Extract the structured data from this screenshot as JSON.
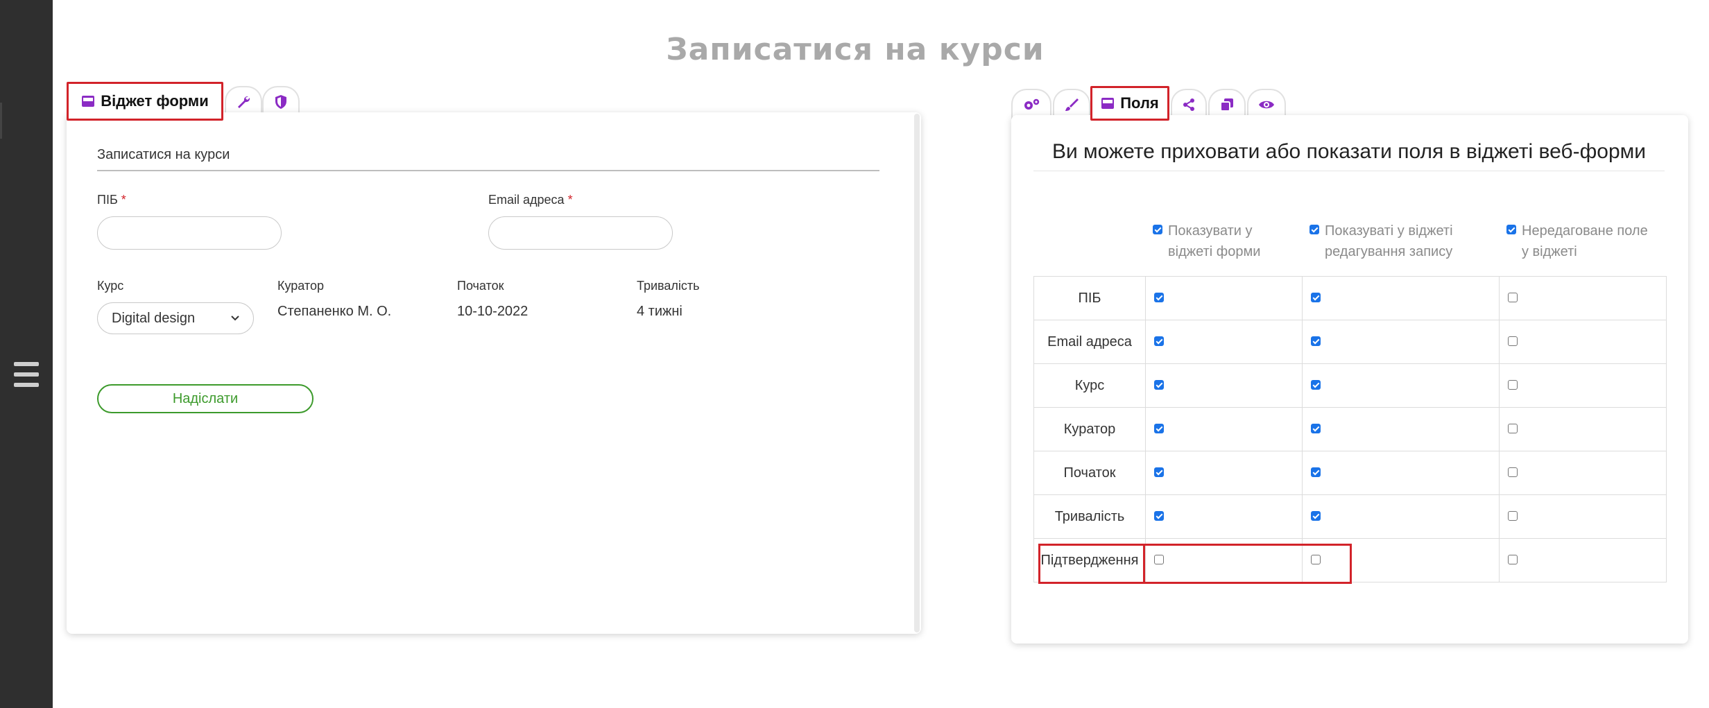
{
  "page": {
    "title": "Записатися на курси"
  },
  "left_tabs": {
    "active_label": "Віджет форми",
    "icons": [
      "form-icon",
      "wrench-icon",
      "shield-icon"
    ]
  },
  "form": {
    "title": "Записатися на курси",
    "name_label": "ПІБ",
    "email_label": "Email адреса",
    "required_mark": "*",
    "course_label": "Курс",
    "course_value": "Digital design",
    "curator_label": "Куратор",
    "curator_value": "Степаненко М. О.",
    "start_label": "Початок",
    "start_value": "10-10-2022",
    "duration_label": "Тривалість",
    "duration_value": "4 тижні",
    "submit_label": "Надіслати"
  },
  "right_tabs": {
    "active_label": "Поля",
    "icons": [
      "gears-icon",
      "brush-icon",
      "form-icon",
      "share-icon",
      "copy-icon",
      "eye-icon"
    ]
  },
  "fields_panel": {
    "title": "Ви можете приховати або показати поля в віджеті веб-форми",
    "columns": [
      {
        "line1": "Показувати у",
        "line2": "віджеті форми",
        "checked": true
      },
      {
        "line1": "Показуваті у віджеті",
        "line2": "редагування запису",
        "checked": true
      },
      {
        "line1": "Нередаговане поле",
        "line2": "у віджеті",
        "checked": true
      }
    ],
    "rows": [
      {
        "name": "ПІБ",
        "show_form": true,
        "show_edit": true,
        "readonly": false
      },
      {
        "name": "Email адреса",
        "show_form": true,
        "show_edit": true,
        "readonly": false
      },
      {
        "name": "Курс",
        "show_form": true,
        "show_edit": true,
        "readonly": false
      },
      {
        "name": "Куратор",
        "show_form": true,
        "show_edit": true,
        "readonly": false
      },
      {
        "name": "Початок",
        "show_form": true,
        "show_edit": true,
        "readonly": false
      },
      {
        "name": "Тривалість",
        "show_form": true,
        "show_edit": true,
        "readonly": false
      },
      {
        "name": "Підтвердження",
        "show_form": false,
        "show_edit": false,
        "readonly": false
      }
    ]
  },
  "colors": {
    "accent": "#8b2bc4",
    "highlight": "#d2232a",
    "submit": "#3c9a2b",
    "checkbox": "#1a73e8",
    "sidebar": "#2f2f2f"
  }
}
